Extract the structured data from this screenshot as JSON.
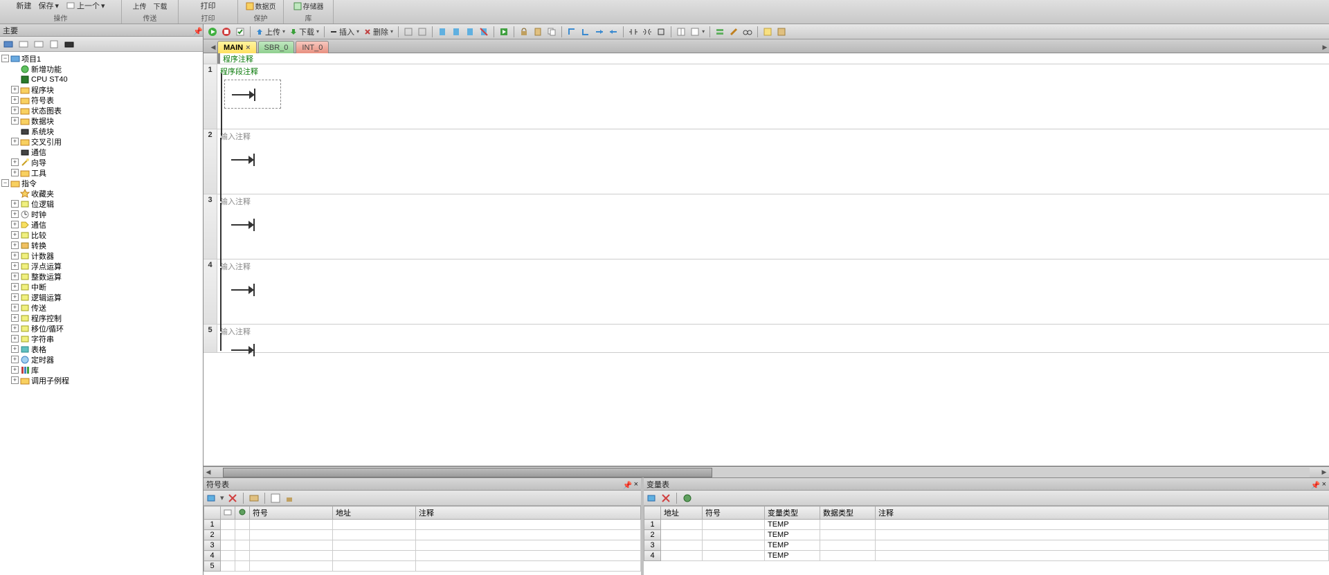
{
  "ribbon": {
    "groups": {
      "new": "新建",
      "save": "保存",
      "prev": "上一个",
      "operation": "操作",
      "upload": "上传",
      "download": "下载",
      "transfer": "传送",
      "print_btn": "打印",
      "print_group": "打印",
      "datapage": "数据页",
      "memory": "存储器",
      "protect": "保护",
      "lib": "库"
    }
  },
  "left_panel": {
    "title": "主要"
  },
  "tree": {
    "project": "项目1",
    "new_feature": "新增功能",
    "cpu": "CPU ST40",
    "program_block": "程序块",
    "symbol_table": "符号表",
    "status_chart": "状态图表",
    "data_block": "数据块",
    "system_block": "系统块",
    "cross_ref": "交叉引用",
    "comm": "通信",
    "wizard": "向导",
    "tools": "工具",
    "instructions": "指令",
    "favorites": "收藏夹",
    "bit_logic": "位逻辑",
    "clock": "时钟",
    "comm2": "通信",
    "compare": "比较",
    "convert": "转换",
    "counter": "计数器",
    "float": "浮点运算",
    "integer": "整数运算",
    "interrupt": "中断",
    "logic": "逻辑运算",
    "move": "传送",
    "program_ctrl": "程序控制",
    "shift": "移位/循环",
    "string": "字符串",
    "table": "表格",
    "timer": "定时器",
    "library": "库",
    "call_sub": "调用子例程"
  },
  "toolbar": {
    "upload": "上传",
    "download": "下载",
    "insert": "插入",
    "delete": "删除"
  },
  "tabs": {
    "main": "MAIN",
    "sbr": "SBR_0",
    "int": "INT_0"
  },
  "editor": {
    "program_comment": "程序注释",
    "seg_comment": "程序段注释",
    "input_comment": "输入注释",
    "rows": [
      "1",
      "2",
      "3",
      "4",
      "5"
    ]
  },
  "symbol_panel": {
    "title": "符号表",
    "cols": {
      "symbol": "符号",
      "address": "地址",
      "comment": "注释"
    },
    "rows": [
      "1",
      "2",
      "3",
      "4",
      "5"
    ]
  },
  "var_panel": {
    "title": "变量表",
    "cols": {
      "address": "地址",
      "symbol": "符号",
      "vartype": "变量类型",
      "datatype": "数据类型",
      "comment": "注释"
    },
    "rows": [
      {
        "n": "1",
        "vartype": "TEMP"
      },
      {
        "n": "2",
        "vartype": "TEMP"
      },
      {
        "n": "3",
        "vartype": "TEMP"
      },
      {
        "n": "4",
        "vartype": "TEMP"
      }
    ]
  }
}
